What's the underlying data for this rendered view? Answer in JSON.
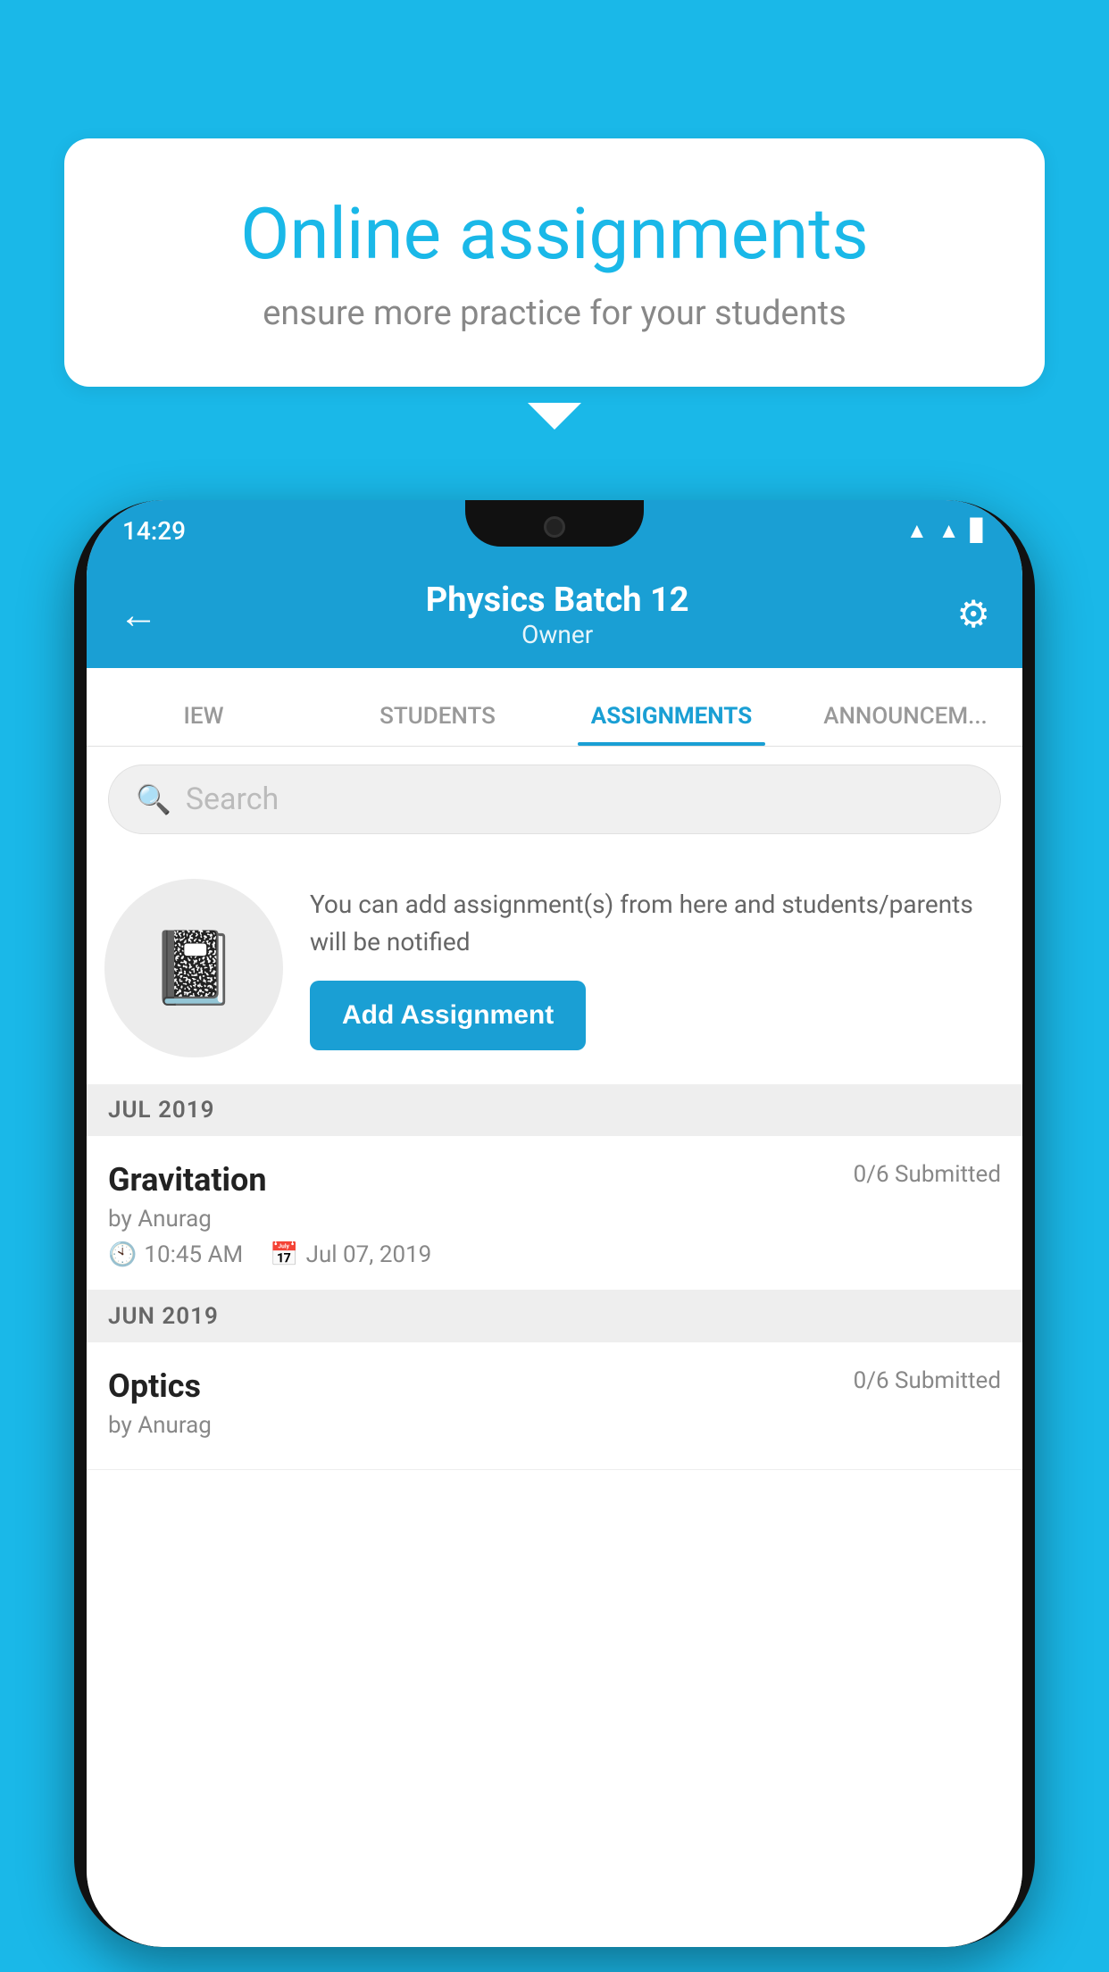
{
  "background_color": "#1ab8e8",
  "speech_bubble": {
    "title": "Online assignments",
    "subtitle": "ensure more practice for your students"
  },
  "status_bar": {
    "time": "14:29",
    "icons": [
      "wifi",
      "signal",
      "battery"
    ]
  },
  "header": {
    "title": "Physics Batch 12",
    "subtitle": "Owner",
    "back_label": "←",
    "settings_label": "⚙"
  },
  "tabs": [
    {
      "label": "IEW",
      "active": false
    },
    {
      "label": "STUDENTS",
      "active": false
    },
    {
      "label": "ASSIGNMENTS",
      "active": true
    },
    {
      "label": "ANNOUNCEM...",
      "active": false
    }
  ],
  "search": {
    "placeholder": "Search"
  },
  "promo": {
    "text": "You can add assignment(s) from here and students/parents will be notified",
    "button_label": "Add Assignment"
  },
  "sections": [
    {
      "label": "JUL 2019",
      "assignments": [
        {
          "name": "Gravitation",
          "submitted": "0/6 Submitted",
          "by": "by Anurag",
          "time": "10:45 AM",
          "date": "Jul 07, 2019"
        }
      ]
    },
    {
      "label": "JUN 2019",
      "assignments": [
        {
          "name": "Optics",
          "submitted": "0/6 Submitted",
          "by": "by Anurag",
          "time": "",
          "date": ""
        }
      ]
    }
  ]
}
